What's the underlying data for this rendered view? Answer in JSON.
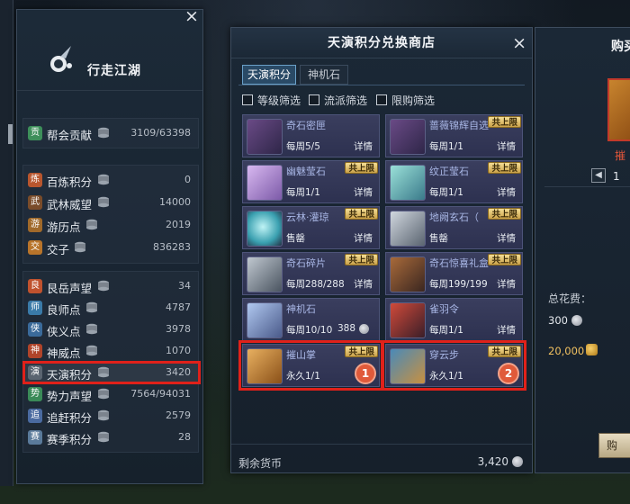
{
  "left_panel": {
    "title": "行走江湖",
    "groups": [
      [
        {
          "icon": "贡",
          "icon_color": "#3d8f5a",
          "name": "帮会贡献",
          "value": "3109/63398"
        }
      ],
      [
        {
          "icon": "炼",
          "icon_color": "#b8562e",
          "name": "百炼积分",
          "value": "0"
        },
        {
          "icon": "武",
          "icon_color": "#7a4c2a",
          "name": "武林威望",
          "value": "14000"
        },
        {
          "icon": "游",
          "icon_color": "#a0692a",
          "name": "游历点",
          "value": "2019"
        },
        {
          "icon": "交",
          "icon_color": "#b8742a",
          "name": "交子",
          "value": "836283"
        }
      ],
      [
        {
          "icon": "良",
          "icon_color": "#c0522e",
          "name": "艮岳声望",
          "value": "34"
        },
        {
          "icon": "师",
          "icon_color": "#3a7aa8",
          "name": "良师点",
          "value": "4787"
        },
        {
          "icon": "侠",
          "icon_color": "#3a6a9a",
          "name": "侠义点",
          "value": "3978"
        },
        {
          "icon": "神",
          "icon_color": "#b0442a",
          "name": "神威点",
          "value": "1070"
        },
        {
          "icon": "演",
          "icon_color": "#5a6470",
          "name": "天演积分",
          "value": "3420",
          "highlight": true
        },
        {
          "icon": "势",
          "icon_color": "#3a8a58",
          "name": "势力声望",
          "value": "7564/94031"
        },
        {
          "icon": "追",
          "icon_color": "#4a6aa0",
          "name": "追赶积分",
          "value": "2579"
        },
        {
          "icon": "赛",
          "icon_color": "#5a7a9a",
          "name": "赛季积分",
          "value": "28"
        }
      ]
    ]
  },
  "shop": {
    "title": "天演积分兑换商店",
    "tabs": [
      "天演积分",
      "神机石"
    ],
    "filters": [
      "等级筛选",
      "流派筛选",
      "限购筛选"
    ],
    "tag_text": "共上限",
    "detail_text": "详情",
    "items": [
      {
        "name": "奇石密匣",
        "limit": "每周5/5",
        "action": "详情",
        "tag": false,
        "thumb": "chest-purple"
      },
      {
        "name": "蔷薇锦辉自选",
        "limit": "每周1/1",
        "action": "详情",
        "tag": true,
        "thumb": "chest-purple"
      },
      {
        "name": "幽魅莹石",
        "limit": "每周1/1",
        "action": "详情",
        "tag": true,
        "thumb": "crystal-pink"
      },
      {
        "name": "纹正莹石",
        "limit": "每周1/1",
        "action": "详情",
        "tag": true,
        "thumb": "crystal-teal"
      },
      {
        "name": "云林·灌琼",
        "limit": "售罄",
        "action": "详情",
        "tag": true,
        "thumb": "orb-cyan"
      },
      {
        "name": "地阙玄石（",
        "limit": "售罄",
        "action": "详情",
        "tag": true,
        "thumb": "rock-grey"
      },
      {
        "name": "奇石碎片",
        "limit": "每周288/288",
        "action": "详情",
        "tag": true,
        "thumb": "shard-grey"
      },
      {
        "name": "奇石惊喜礼盒",
        "limit": "每周199/199",
        "action": "详情",
        "tag": true,
        "thumb": "chest-brown"
      },
      {
        "name": "神机石",
        "limit": "每周10/10",
        "action": "",
        "price": "388",
        "tag": false,
        "thumb": "stone-blue"
      },
      {
        "name": "雀羽令",
        "limit": "每周1/1",
        "action": "详情",
        "tag": false,
        "thumb": "token-red"
      },
      {
        "name": "摧山掌",
        "limit": "永久1/1",
        "action": "",
        "tag": true,
        "thumb": "scroll-gold",
        "highlight": true,
        "badge": "1"
      },
      {
        "name": "穿云步",
        "limit": "永久1/1",
        "action": "",
        "tag": true,
        "thumb": "scroll-blue",
        "highlight": true,
        "badge": "2"
      }
    ],
    "remain_label": "剩余货币",
    "remain_value": "3,420"
  },
  "buy_panel": {
    "title": "购买",
    "item_name": "摧",
    "qty": "1",
    "total_label": "总花费：",
    "total_value": "300",
    "money_value": "20,000",
    "buy_button": "购"
  },
  "colors": {
    "highlight_red": "#e0211a",
    "tag_gold": "#f4dd94",
    "card_purple": "#3a3e5e",
    "accent_blue": "#6aa0c8"
  }
}
